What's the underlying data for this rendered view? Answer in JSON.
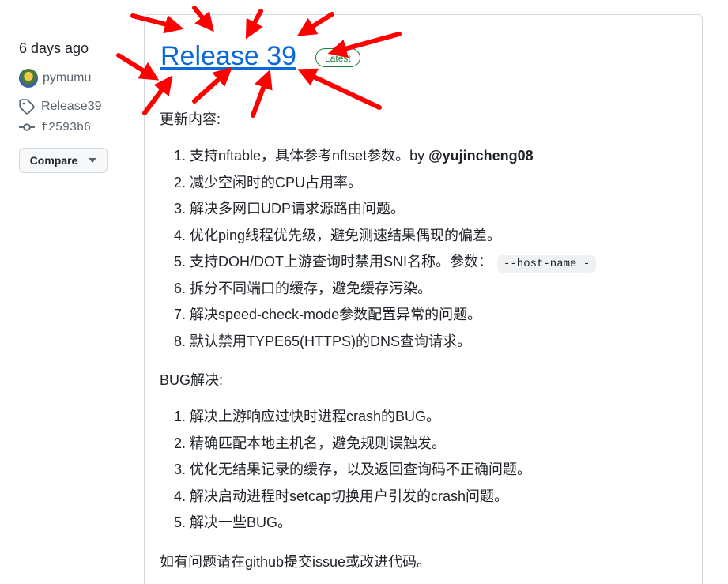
{
  "sidebar": {
    "date": "6 days ago",
    "author": "pymumu",
    "tag": "Release39",
    "commit": "f2593b6",
    "compare_label": "Compare"
  },
  "release": {
    "title": "Release 39",
    "badge": "Latest",
    "section1_heading": "更新内容:",
    "updates": [
      {
        "text": "支持nftable，具体参考nftset参数。by ",
        "mention": "@yujincheng08"
      },
      {
        "text": "减少空闲时的CPU占用率。"
      },
      {
        "text": "解决多网口UDP请求源路由问题。"
      },
      {
        "text": "优化ping线程优先级，避免测速结果偶现的偏差。"
      },
      {
        "text": "支持DOH/DOT上游查询时禁用SNI名称。参数：",
        "code": "--host-name -"
      },
      {
        "text": "拆分不同端口的缓存，避免缓存污染。"
      },
      {
        "text": "解决speed-check-mode参数配置异常的问题。"
      },
      {
        "text": "默认禁用TYPE65(HTTPS)的DNS查询请求。"
      }
    ],
    "section2_heading": "BUG解决:",
    "bugfixes": [
      "解决上游响应过快时进程crash的BUG。",
      "精确匹配本地主机名，避免规则误触发。",
      "优化无结果记录的缓存，以及返回查询码不正确问题。",
      "解决启动进程时setcap切换用户引发的crash问题。",
      "解决一些BUG。"
    ],
    "footer": "如有问题请在github提交issue或改进代码。"
  },
  "colors": {
    "link": "#0969da",
    "badge_green": "#1a7f37",
    "annotation_red": "#ff0000"
  }
}
